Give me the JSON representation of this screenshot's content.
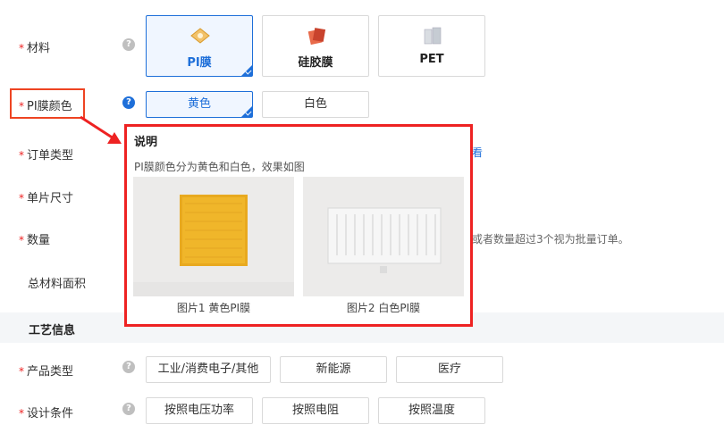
{
  "material": {
    "label": "材料",
    "options": [
      {
        "label": "PI膜",
        "selected": true,
        "icon": "pi-film-icon"
      },
      {
        "label": "硅胶膜",
        "selected": false,
        "icon": "silicone-film-icon"
      },
      {
        "label": "PET",
        "selected": false,
        "icon": "pet-film-icon"
      }
    ]
  },
  "pi_color": {
    "label": "PI膜颜色",
    "options": [
      {
        "label": "黄色",
        "selected": true
      },
      {
        "label": "白色",
        "selected": false
      }
    ]
  },
  "order_type": {
    "label": "订单类型",
    "link_fragment": "看"
  },
  "piece_size": {
    "label": "单片尺寸"
  },
  "quantity": {
    "label": "数量",
    "hint": "或者数量超过3个视为批量订单。"
  },
  "total_area": {
    "label": "总材料面积"
  },
  "process_section": {
    "title": "工艺信息"
  },
  "product_type": {
    "label": "产品类型",
    "options": [
      {
        "label": "工业/消费电子/其他"
      },
      {
        "label": "新能源"
      },
      {
        "label": "医疗"
      }
    ]
  },
  "design_condition": {
    "label": "设计条件",
    "options": [
      {
        "label": "按照电压功率"
      },
      {
        "label": "按照电阻"
      },
      {
        "label": "按照温度"
      }
    ]
  },
  "popup": {
    "title": "说明",
    "description": "PI膜颜色分为黄色和白色，效果如图",
    "images": [
      {
        "caption": "图片1 黄色PI膜"
      },
      {
        "caption": "图片2 白色PI膜"
      }
    ]
  },
  "colors": {
    "accent": "#1e6fd9",
    "required": "#e22222",
    "highlight": "#e42222"
  }
}
